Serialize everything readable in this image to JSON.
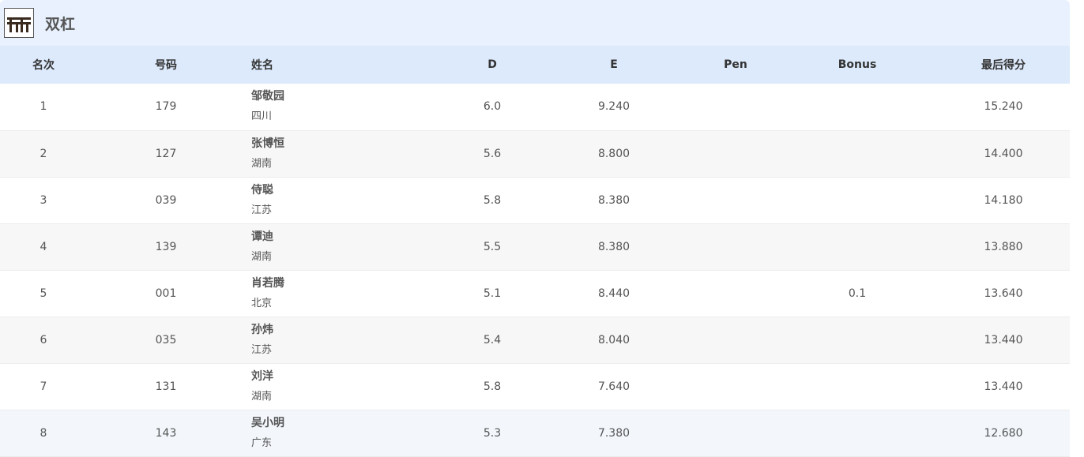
{
  "header": {
    "icon": "parallel-bars-icon",
    "title": "双杠"
  },
  "table": {
    "columns": {
      "rank": "名次",
      "number": "号码",
      "name": "姓名",
      "d": "D",
      "e": "E",
      "pen": "Pen",
      "bonus": "Bonus",
      "final": "最后得分"
    },
    "rows": [
      {
        "rank": "1",
        "number": "179",
        "name": "邹敬园",
        "team": "四川",
        "d": "6.0",
        "e": "9.240",
        "pen": "",
        "bonus": "",
        "final": "15.240"
      },
      {
        "rank": "2",
        "number": "127",
        "name": "张博恒",
        "team": "湖南",
        "d": "5.6",
        "e": "8.800",
        "pen": "",
        "bonus": "",
        "final": "14.400"
      },
      {
        "rank": "3",
        "number": "039",
        "name": "侍聪",
        "team": "江苏",
        "d": "5.8",
        "e": "8.380",
        "pen": "",
        "bonus": "",
        "final": "14.180"
      },
      {
        "rank": "4",
        "number": "139",
        "name": "谭迪",
        "team": "湖南",
        "d": "5.5",
        "e": "8.380",
        "pen": "",
        "bonus": "",
        "final": "13.880"
      },
      {
        "rank": "5",
        "number": "001",
        "name": "肖若腾",
        "team": "北京",
        "d": "5.1",
        "e": "8.440",
        "pen": "",
        "bonus": "0.1",
        "final": "13.640"
      },
      {
        "rank": "6",
        "number": "035",
        "name": "孙炜",
        "team": "江苏",
        "d": "5.4",
        "e": "8.040",
        "pen": "",
        "bonus": "",
        "final": "13.440"
      },
      {
        "rank": "7",
        "number": "131",
        "name": "刘洋",
        "team": "湖南",
        "d": "5.8",
        "e": "7.640",
        "pen": "",
        "bonus": "",
        "final": "13.440"
      },
      {
        "rank": "8",
        "number": "143",
        "name": "吴小明",
        "team": "广东",
        "d": "5.3",
        "e": "7.380",
        "pen": "",
        "bonus": "",
        "final": "12.680"
      }
    ]
  }
}
